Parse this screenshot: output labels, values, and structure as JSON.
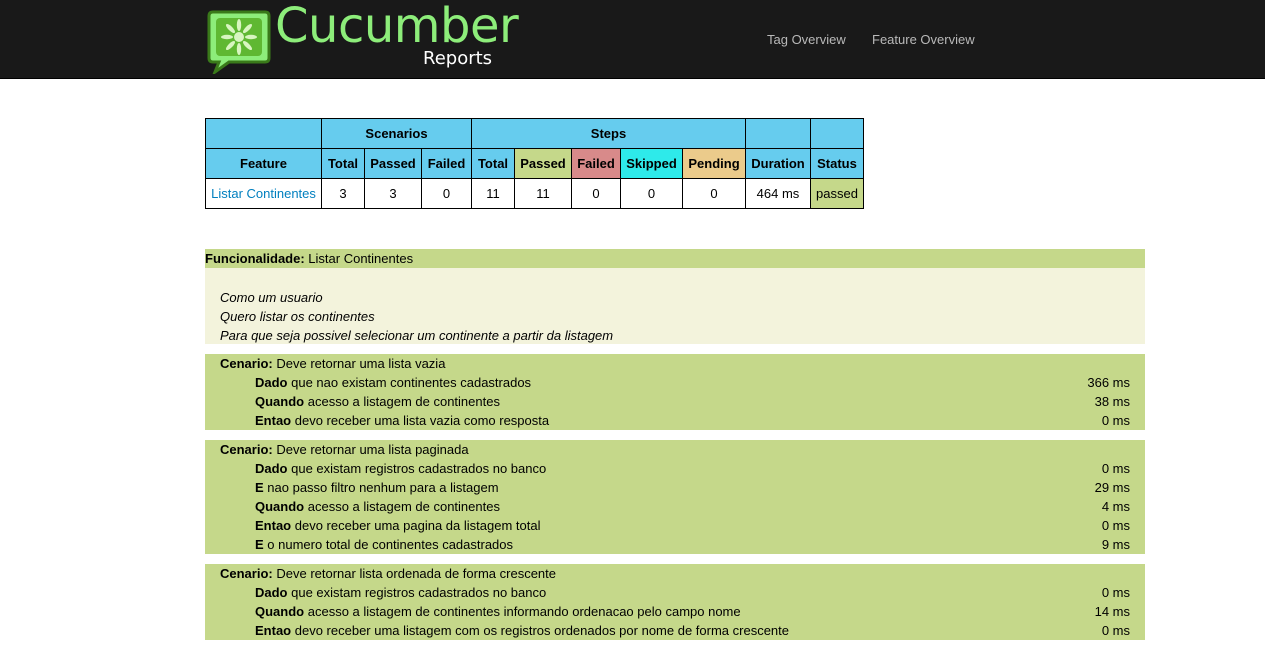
{
  "header": {
    "logo_title": "Cucumber",
    "logo_subtitle": "Reports",
    "nav": [
      "Tag Overview",
      "Feature Overview"
    ]
  },
  "summary": {
    "group_headers": {
      "scenarios": "Scenarios",
      "steps": "Steps"
    },
    "columns": [
      "Feature",
      "Total",
      "Passed",
      "Failed",
      "Total",
      "Passed",
      "Failed",
      "Skipped",
      "Pending",
      "Duration",
      "Status"
    ],
    "row": {
      "feature": "Listar Continentes",
      "scenarios_total": "3",
      "scenarios_passed": "3",
      "scenarios_failed": "0",
      "steps_total": "11",
      "steps_passed": "11",
      "steps_failed": "0",
      "steps_skipped": "0",
      "steps_pending": "0",
      "duration": "464 ms",
      "status": "passed"
    }
  },
  "feature": {
    "keyword": "Funcionalidade:",
    "name": "Listar Continentes",
    "description": [
      "Como um usuario",
      "Quero listar os continentes",
      "Para que seja possivel selecionar um continente a partir da listagem"
    ]
  },
  "scenarios": [
    {
      "keyword": "Cenario:",
      "name": "Deve retornar uma lista vazia",
      "steps": [
        {
          "keyword": "Dado",
          "text": "que nao existam continentes cadastrados",
          "duration": "366 ms"
        },
        {
          "keyword": "Quando",
          "text": "acesso a listagem de continentes",
          "duration": "38 ms"
        },
        {
          "keyword": "Entao",
          "text": "devo receber uma lista vazia como resposta",
          "duration": "0 ms"
        }
      ]
    },
    {
      "keyword": "Cenario:",
      "name": "Deve retornar uma lista paginada",
      "steps": [
        {
          "keyword": "Dado",
          "text": "que existam registros cadastrados no banco",
          "duration": "0 ms"
        },
        {
          "keyword": "E",
          "text": "nao passo filtro nenhum para a listagem",
          "duration": "29 ms"
        },
        {
          "keyword": "Quando",
          "text": "acesso a listagem de continentes",
          "duration": "4 ms"
        },
        {
          "keyword": "Entao",
          "text": "devo receber uma pagina da listagem total",
          "duration": "0 ms"
        },
        {
          "keyword": "E",
          "text": "o numero total de continentes cadastrados",
          "duration": "9 ms"
        }
      ]
    },
    {
      "keyword": "Cenario:",
      "name": "Deve retornar lista ordenada de forma crescente",
      "steps": [
        {
          "keyword": "Dado",
          "text": "que existam registros cadastrados no banco",
          "duration": "0 ms"
        },
        {
          "keyword": "Quando",
          "text": "acesso a listagem de continentes informando ordenacao pelo campo nome",
          "duration": "14 ms"
        },
        {
          "keyword": "Entao",
          "text": "devo receber uma listagem com os registros ordenados por nome de forma crescente",
          "duration": "0 ms"
        }
      ]
    }
  ]
}
